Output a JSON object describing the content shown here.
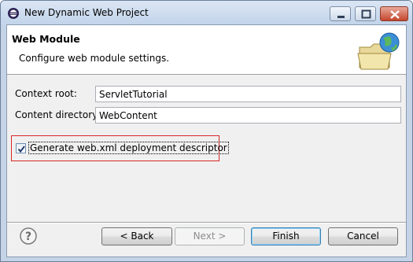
{
  "window": {
    "title": "New Dynamic Web Project"
  },
  "banner": {
    "title": "Web Module",
    "description": "Configure web module settings.",
    "image_icon": "folder-globe-icon"
  },
  "form": {
    "context_root": {
      "label": "Context root:",
      "value": "ServletTutorial"
    },
    "content_directory": {
      "label": "Content directory:",
      "value": "WebContent"
    },
    "generate_web_xml": {
      "label": "Generate web.xml deployment descriptor",
      "checked": true
    }
  },
  "buttons": {
    "back": "< Back",
    "next": "Next >",
    "finish": "Finish",
    "cancel": "Cancel"
  },
  "icons": {
    "help": "help-question-icon",
    "app": "eclipse-icon"
  },
  "colors": {
    "highlight_border": "#d92626",
    "titlebar": "#c2d4ea"
  }
}
